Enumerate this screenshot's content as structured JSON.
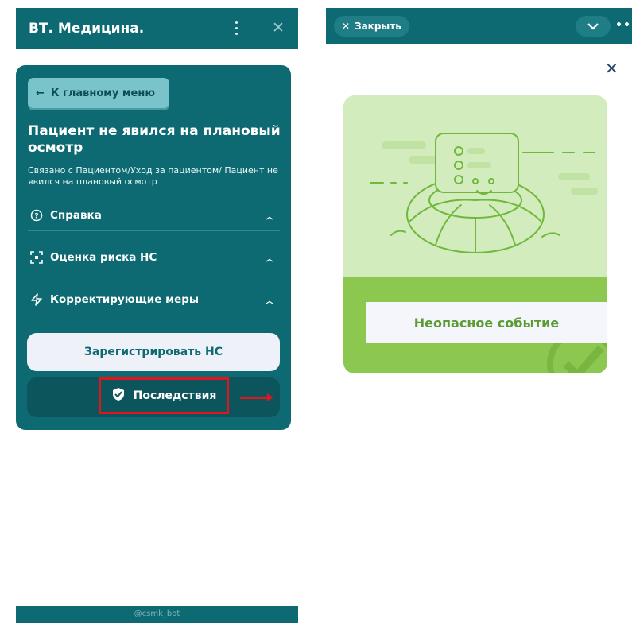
{
  "left_panel": {
    "header": {
      "title": "ВТ. Медицина.",
      "menu_icon": "kebab-icon",
      "close_icon": "close-icon"
    },
    "back_button": {
      "label": "К главному меню"
    },
    "card": {
      "title": "Пациент не явился на плановый осмотр",
      "subtitle": "Связано с Пациентом/Уход за пациентом/ Пациент не явился на плановый осмотр",
      "sections": [
        {
          "label": "Справка",
          "icon": "question-icon"
        },
        {
          "label": "Оценка риска НС",
          "icon": "focus-icon"
        },
        {
          "label": "Корректирующие меры",
          "icon": "lightning-icon"
        }
      ],
      "register_button": "Зарегистрировать НС",
      "consequences_button": "Последствия"
    },
    "footer": {
      "bot_name": "@csmk_bot"
    }
  },
  "right_panel": {
    "header": {
      "close_label": "Закрыть"
    },
    "modal": {
      "event_button": "Неопасное событие"
    }
  },
  "colors": {
    "teal": "#0e6a72",
    "light_teal": "#79c4cb",
    "green_light": "#d2ecbd",
    "green": "#8cc750",
    "highlight_red": "#e0161a"
  }
}
